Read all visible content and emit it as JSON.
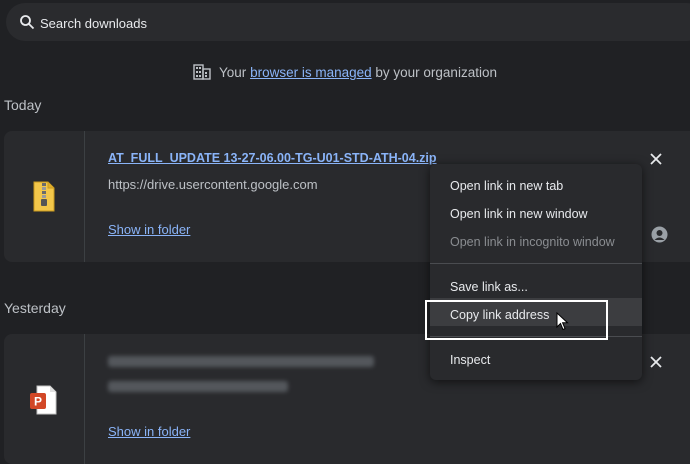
{
  "search": {
    "placeholder": "Search downloads"
  },
  "managed": {
    "prefix": "Your",
    "link": "browser is managed",
    "suffix": "by your organization"
  },
  "sections": {
    "today": "Today",
    "yesterday": "Yesterday"
  },
  "downloads": [
    {
      "filename": "AT_FULL_UPDATE 13-27-06.00-TG-U01-STD-ATH-04.zip",
      "url": "https://drive.usercontent.google.com",
      "action": "Show in folder",
      "icon": "zip-file-icon"
    },
    {
      "filename": "",
      "url": "",
      "action": "Show in folder",
      "icon": "powerpoint-file-icon"
    }
  ],
  "context_menu": {
    "items": [
      {
        "label": "Open link in new tab",
        "enabled": true
      },
      {
        "label": "Open link in new window",
        "enabled": true
      },
      {
        "label": "Open link in incognito window",
        "enabled": false
      },
      {
        "label": "Save link as...",
        "enabled": true
      },
      {
        "label": "Copy link address",
        "enabled": true,
        "highlighted": true
      },
      {
        "label": "Inspect",
        "enabled": true
      }
    ]
  },
  "colors": {
    "background": "#202124",
    "card": "#292a2d",
    "link": "#8ab4f8",
    "text": "#e8eaed"
  }
}
